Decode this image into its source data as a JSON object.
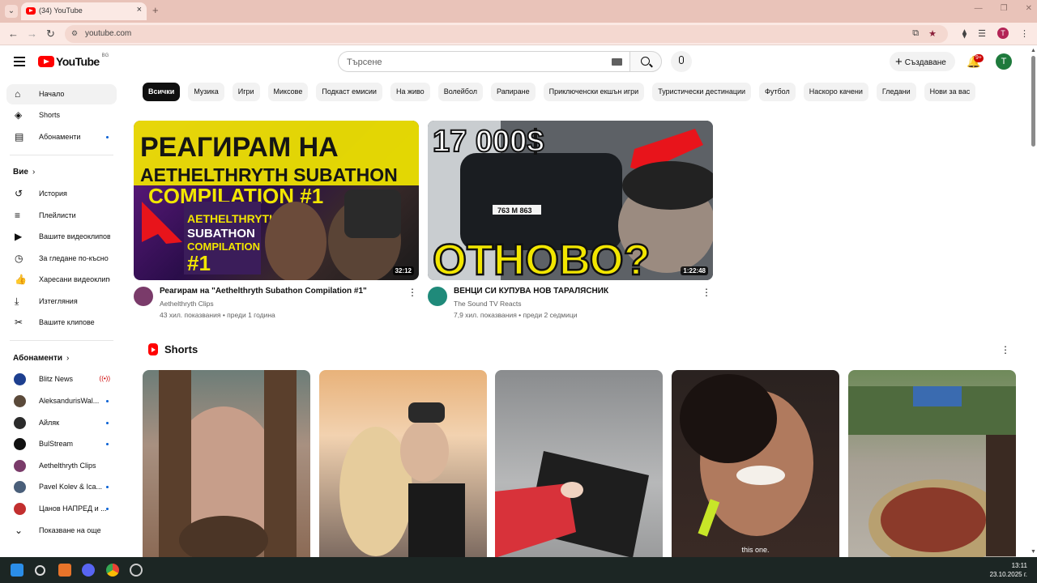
{
  "browser": {
    "tab_title": "(34) YouTube",
    "tab_close": "×",
    "new_tab": "+",
    "url": "youtube.com",
    "profile_initial": "T",
    "window_controls": [
      "—",
      "❐",
      "✕"
    ]
  },
  "masthead": {
    "logo_text": "YouTube",
    "country": "BG",
    "search_placeholder": "Търсене",
    "create_label": "Създаване",
    "notification_badge": "9+",
    "avatar_initial": "T"
  },
  "sidebar": {
    "main": [
      {
        "label": "Начало",
        "icon": "home-icon",
        "glyph": "⌂"
      },
      {
        "label": "Shorts",
        "icon": "shorts-icon",
        "glyph": "◈"
      },
      {
        "label": "Абонаменти",
        "icon": "subscriptions-icon",
        "glyph": "▤"
      }
    ],
    "you_heading": "Вие",
    "you": [
      {
        "label": "История",
        "icon": "history-icon",
        "glyph": "↺"
      },
      {
        "label": "Плейлисти",
        "icon": "playlists-icon",
        "glyph": "≡"
      },
      {
        "label": "Вашите видеоклипове",
        "icon": "your-videos-icon",
        "glyph": "▶"
      },
      {
        "label": "За гледане по-късно",
        "icon": "watch-later-icon",
        "glyph": "◷"
      },
      {
        "label": "Харесани видеоклипове",
        "icon": "liked-icon",
        "glyph": "👍"
      },
      {
        "label": "Изтегляния",
        "icon": "downloads-icon",
        "glyph": "⤓"
      },
      {
        "label": "Вашите клипове",
        "icon": "clips-icon",
        "glyph": "✂"
      }
    ],
    "subs_heading": "Абонаменти",
    "subs": [
      {
        "label": "Blitz News",
        "color": "#1d3f8f",
        "live": "((•))"
      },
      {
        "label": "AleksandurisWal...",
        "color": "#5b4a3a"
      },
      {
        "label": "Айляк",
        "color": "#2b2b2b"
      },
      {
        "label": "BulStream",
        "color": "#111111"
      },
      {
        "label": "Aethelthryth Clips",
        "color": "#7a3b6a"
      },
      {
        "label": "Pavel Kolev & Ica...",
        "color": "#4a5f7a"
      },
      {
        "label": "Цанов НАПРЕД и ...",
        "color": "#c22f2f"
      }
    ],
    "show_more": "Показване на още"
  },
  "chips": [
    "Всички",
    "Музика",
    "Игри",
    "Миксове",
    "Подкаст емисии",
    "На живо",
    "Волейбол",
    "Рапиране",
    "Приключенски екшън игри",
    "Туристически дестинации",
    "Футбол",
    "Наскоро качени",
    "Гледани",
    "Нови за вас"
  ],
  "videos": [
    {
      "title": "Реагирам на \"Aethelthryth Subathon Compilation #1\"",
      "channel": "Aethelthryth Clips",
      "meta": "43 хил. показвания • преди 1 година",
      "duration": "32:12",
      "thumb_text": [
        "РЕАГИРАМ НА",
        "AETHELTHRYTH SUBATHON",
        "COMPILATION #1",
        "AETHELTHRYTH",
        "SUBATHON",
        "COMPILATION",
        "#1"
      ]
    },
    {
      "title": "ВЕНЦИ СИ КУПУВА НОВ ТАРАЛЯСНИК",
      "channel": "The Sound TV Reacts",
      "meta": "7,9 хил. показвания • преди 2 седмици",
      "duration": "1:22:48",
      "thumb_text": [
        "17 000$",
        "ОТНОВО?",
        "763 М 863"
      ]
    }
  ],
  "shorts": {
    "heading": "Shorts",
    "caption_4": "this one."
  },
  "taskbar": {
    "time": "13:11",
    "date": "23.10.2025 г."
  }
}
